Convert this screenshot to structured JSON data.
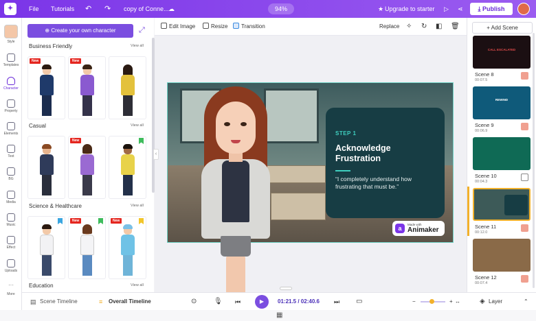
{
  "topbar": {
    "menu_file": "File",
    "menu_tutorials": "Tutorials",
    "project_name": "copy of Conne...",
    "zoom": "94%",
    "upgrade": "Upgrade to starter",
    "publish": "Publish"
  },
  "rail": [
    {
      "label": "Style",
      "icon": "avatar-icon"
    },
    {
      "label": "Templates",
      "icon": "templates-icon"
    },
    {
      "label": "Character",
      "icon": "character-icon"
    },
    {
      "label": "Property",
      "icon": "property-icon"
    },
    {
      "label": "Elements",
      "icon": "elements-icon"
    },
    {
      "label": "Text",
      "icon": "text-icon"
    },
    {
      "label": "BG",
      "icon": "bg-icon"
    },
    {
      "label": "Media",
      "icon": "media-icon"
    },
    {
      "label": "Music",
      "icon": "music-icon"
    },
    {
      "label": "Effect",
      "icon": "effect-icon"
    },
    {
      "label": "Uploads",
      "icon": "uploads-icon"
    },
    {
      "label": "More",
      "icon": "more-icon"
    }
  ],
  "library": {
    "create_button": "Create your own character",
    "view_all": "View all",
    "badge_new": "New",
    "sections": [
      {
        "title": "Business Friendly"
      },
      {
        "title": "Casual"
      },
      {
        "title": "Science & Healthcare"
      },
      {
        "title": "Education"
      }
    ]
  },
  "toolbar": {
    "edit_image": "Edit Image",
    "resize": "Resize",
    "transition": "Transition",
    "replace": "Replace"
  },
  "slide": {
    "step": "STEP 1",
    "heading": "Acknowledge Frustration",
    "quote": "“I completely understand how frustrating that must be.”",
    "watermark_small": "Made with",
    "watermark_brand": "Animaker"
  },
  "scenes": {
    "add_button": "+ Add Scene",
    "list": [
      {
        "name": "Scene 8",
        "time": "00:07.5",
        "thumb_text": "CALL ESCALATED",
        "color": "#1b0f12"
      },
      {
        "name": "Scene 9",
        "time": "00:06.9",
        "thumb_text": "REWIND",
        "color": "#0f5a7a"
      },
      {
        "name": "Scene 10",
        "time": "00:04.3",
        "thumb_text": "",
        "color": "#0f6a55"
      },
      {
        "name": "Scene 11",
        "time": "00:12.0",
        "thumb_text": "",
        "color": "#3d5a58"
      },
      {
        "name": "Scene 12",
        "time": "00:07.4",
        "thumb_text": "",
        "color": "#8a6a48"
      }
    ]
  },
  "bottombar": {
    "scene_timeline": "Scene Timeline",
    "overall_timeline": "Overall Timeline",
    "time": "01:21.5 / 02:40.6",
    "layer": "Layer"
  },
  "colors": {
    "accent": "#7b35e8",
    "highlight": "#f2b12b",
    "panel": "#173d44",
    "teal": "#3fd0c0"
  }
}
